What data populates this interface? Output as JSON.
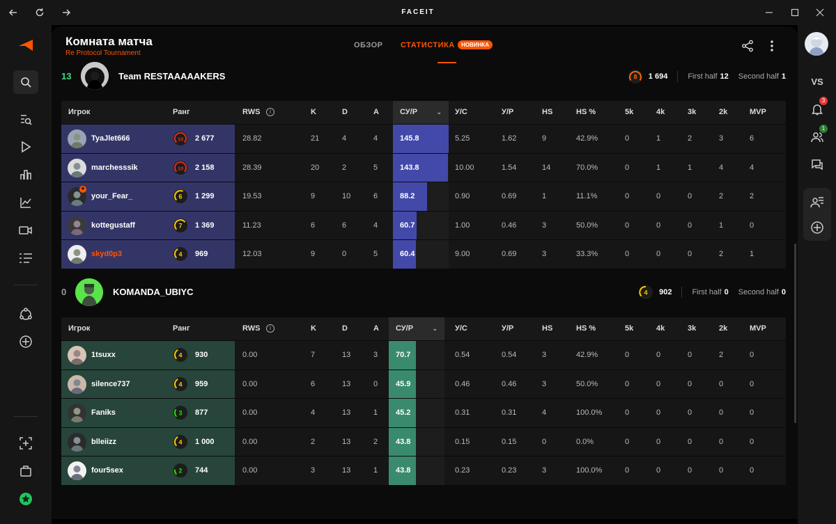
{
  "window": {
    "logo": "FACEIT"
  },
  "header": {
    "title": "Комната матча",
    "subtitle": "Re Protocol Tournament",
    "tabs": [
      {
        "label": "ОБЗОР",
        "active": false
      },
      {
        "label": "СТАТИСТИКА",
        "active": true,
        "badge": "НОВИНКА"
      }
    ]
  },
  "right_sidebar": {
    "vs_label": "VS",
    "notifications_badge": "3",
    "friends_badge": "1"
  },
  "columns": {
    "player": "Игрок",
    "rank": "Ранг",
    "rws": "RWS",
    "k": "K",
    "d": "D",
    "a": "A",
    "kr": "СУ/Р",
    "kd": "У/С",
    "kpr": "У/Р",
    "hs": "HS",
    "hs_pct": "HS %",
    "k5": "5k",
    "k4": "4k",
    "k3": "3k",
    "k2": "2k",
    "mvp": "MVP"
  },
  "teams": [
    {
      "score": "13",
      "score_color": "#3ddc84",
      "name": "Team RESTAAAAAKERS",
      "avg_level": "8",
      "avg_elo": "1 694",
      "first_half_label": "First half",
      "first_half": "12",
      "second_half_label": "Second half",
      "second_half": "1",
      "players": [
        {
          "name": "TyaJlet666",
          "level": "10",
          "elo": "2 677",
          "rws": "28.82",
          "k": "21",
          "d": "4",
          "a": "4",
          "kr": "145.8",
          "kr_fill": 1.0,
          "kd": "5.25",
          "kpr": "1.62",
          "hs": "9",
          "hs_pct": "42.9%",
          "k5": "0",
          "k4": "1",
          "k3": "2",
          "k2": "3",
          "mvp": "6"
        },
        {
          "name": "marchesssik",
          "level": "10",
          "elo": "2 158",
          "rws": "28.39",
          "k": "20",
          "d": "2",
          "a": "5",
          "kr": "143.8",
          "kr_fill": 0.99,
          "kd": "10.00",
          "kpr": "1.54",
          "hs": "14",
          "hs_pct": "70.0%",
          "k5": "0",
          "k4": "1",
          "k3": "1",
          "k2": "4",
          "mvp": "4"
        },
        {
          "name": "your_Fear_",
          "level": "6",
          "elo": "1 299",
          "rws": "19.53",
          "k": "9",
          "d": "10",
          "a": "6",
          "kr": "88.2",
          "kr_fill": 0.61,
          "kd": "0.90",
          "kpr": "0.69",
          "hs": "1",
          "hs_pct": "11.1%",
          "k5": "0",
          "k4": "0",
          "k3": "0",
          "k2": "2",
          "mvp": "2"
        },
        {
          "name": "kottegustaff",
          "level": "7",
          "elo": "1 369",
          "rws": "11.23",
          "k": "6",
          "d": "6",
          "a": "4",
          "kr": "60.7",
          "kr_fill": 0.42,
          "kd": "1.00",
          "kpr": "0.46",
          "hs": "3",
          "hs_pct": "50.0%",
          "k5": "0",
          "k4": "0",
          "k3": "0",
          "k2": "1",
          "mvp": "0"
        },
        {
          "name": "skyd0p3",
          "level": "4",
          "elo": "969",
          "rws": "12.03",
          "k": "9",
          "d": "0",
          "a": "5",
          "kr": "60.4",
          "kr_fill": 0.41,
          "kd": "9.00",
          "kpr": "0.69",
          "hs": "3",
          "hs_pct": "33.3%",
          "k5": "0",
          "k4": "0",
          "k3": "0",
          "k2": "2",
          "mvp": "1",
          "is_me": true
        }
      ]
    },
    {
      "score": "0",
      "score_color": "#9a9a9a",
      "name": "KOMANDA_UBIYC",
      "avg_level": "4",
      "avg_elo": "902",
      "first_half_label": "First half",
      "first_half": "0",
      "second_half_label": "Second half",
      "second_half": "0",
      "players": [
        {
          "name": "1tsuxx",
          "level": "4",
          "elo": "930",
          "rws": "0.00",
          "k": "7",
          "d": "13",
          "a": "3",
          "kr": "70.7",
          "kr_fill": 0.49,
          "kd": "0.54",
          "kpr": "0.54",
          "hs": "3",
          "hs_pct": "42.9%",
          "k5": "0",
          "k4": "0",
          "k3": "0",
          "k2": "2",
          "mvp": "0"
        },
        {
          "name": "silence737",
          "level": "4",
          "elo": "959",
          "rws": "0.00",
          "k": "6",
          "d": "13",
          "a": "0",
          "kr": "45.9",
          "kr_fill": 0.49,
          "kd": "0.46",
          "kpr": "0.46",
          "hs": "3",
          "hs_pct": "50.0%",
          "k5": "0",
          "k4": "0",
          "k3": "0",
          "k2": "0",
          "mvp": "0"
        },
        {
          "name": "Faniks",
          "level": "3",
          "elo": "877",
          "rws": "0.00",
          "k": "4",
          "d": "13",
          "a": "1",
          "kr": "45.2",
          "kr_fill": 0.49,
          "kd": "0.31",
          "kpr": "0.31",
          "hs": "4",
          "hs_pct": "100.0%",
          "k5": "0",
          "k4": "0",
          "k3": "0",
          "k2": "0",
          "mvp": "0"
        },
        {
          "name": "blleiizz",
          "level": "4",
          "elo": "1 000",
          "rws": "0.00",
          "k": "2",
          "d": "13",
          "a": "2",
          "kr": "43.8",
          "kr_fill": 0.49,
          "kd": "0.15",
          "kpr": "0.15",
          "hs": "0",
          "hs_pct": "0.0%",
          "k5": "0",
          "k4": "0",
          "k3": "0",
          "k2": "0",
          "mvp": "0"
        },
        {
          "name": "four5sex",
          "level": "2",
          "elo": "744",
          "rws": "0.00",
          "k": "3",
          "d": "13",
          "a": "1",
          "kr": "43.8",
          "kr_fill": 0.49,
          "kd": "0.23",
          "kpr": "0.23",
          "hs": "3",
          "hs_pct": "100.0%",
          "k5": "0",
          "k4": "0",
          "k3": "0",
          "k2": "0",
          "mvp": "0"
        }
      ]
    }
  ],
  "colors": {
    "accent": "#ff5500",
    "level_red": "#e8291c",
    "level_yellow": "#ffc800",
    "level_green": "#1ce400",
    "level_orange": "#ff6309"
  }
}
